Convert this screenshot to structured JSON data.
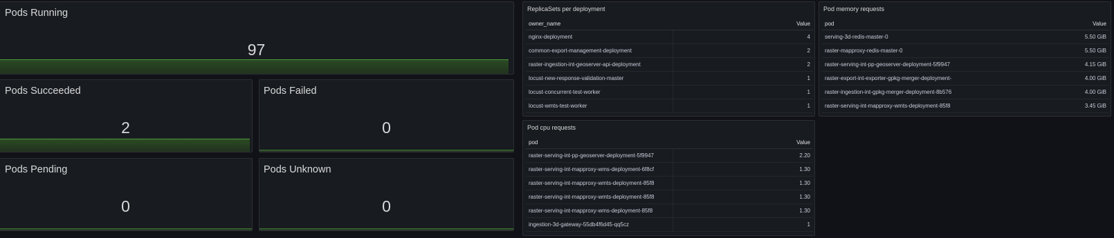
{
  "stats": {
    "running": {
      "title": "Pods Running",
      "value": "97"
    },
    "succeeded": {
      "title": "Pods Succeeded",
      "value": "2"
    },
    "failed": {
      "title": "Pods Failed",
      "value": "0"
    },
    "pending": {
      "title": "Pods Pending",
      "value": "0"
    },
    "unknown": {
      "title": "Pods Unknown",
      "value": "0"
    }
  },
  "replicasets": {
    "title": "ReplicaSets per deployment",
    "columns": [
      "owner_name",
      "Value"
    ],
    "rows": [
      [
        "nginx-deployment",
        "4"
      ],
      [
        "common-export-management-deployment",
        "2"
      ],
      [
        "raster-ingestion-int-geoserver-api-deployment",
        "2"
      ],
      [
        "locust-new-response-validation-master",
        "1"
      ],
      [
        "locust-concurrent-test-worker",
        "1"
      ],
      [
        "locust-wmts-test-worker",
        "1"
      ]
    ]
  },
  "cpu": {
    "title": "Pod cpu requests",
    "columns": [
      "pod",
      "Value"
    ],
    "rows": [
      [
        "raster-serving-int-pp-geoserver-deployment-5f9947",
        "2.20"
      ],
      [
        "raster-serving-int-mapproxy-wms-deployment-6f8cf",
        "1.30"
      ],
      [
        "raster-serving-int-mapproxy-wmts-deployment-85f8",
        "1.30"
      ],
      [
        "raster-serving-int-mapproxy-wmts-deployment-85f8",
        "1.30"
      ],
      [
        "raster-serving-int-mapproxy-wms-deployment-85f8",
        "1.30"
      ],
      [
        "ingestion-3d-gateway-55db4f6d45-qq5cz",
        "1"
      ]
    ]
  },
  "memory": {
    "title": "Pod memory requests",
    "columns": [
      "pod",
      "Value"
    ],
    "rows": [
      [
        "serving-3d-redis-master-0",
        "5.50 GiB"
      ],
      [
        "raster-mapproxy-redis-master-0",
        "5.50 GiB"
      ],
      [
        "raster-serving-int-pp-geoserver-deployment-5f9947",
        "4.15 GiB"
      ],
      [
        "raster-export-int-exporter-gpkg-merger-deployment-",
        "4.00 GiB"
      ],
      [
        "raster-ingestion-int-gpkg-merger-deployment-8b576",
        "4.00 GiB"
      ],
      [
        "raster-serving-int-mapproxy-wmts-deployment-85f8",
        "3.45 GiB"
      ]
    ]
  }
}
